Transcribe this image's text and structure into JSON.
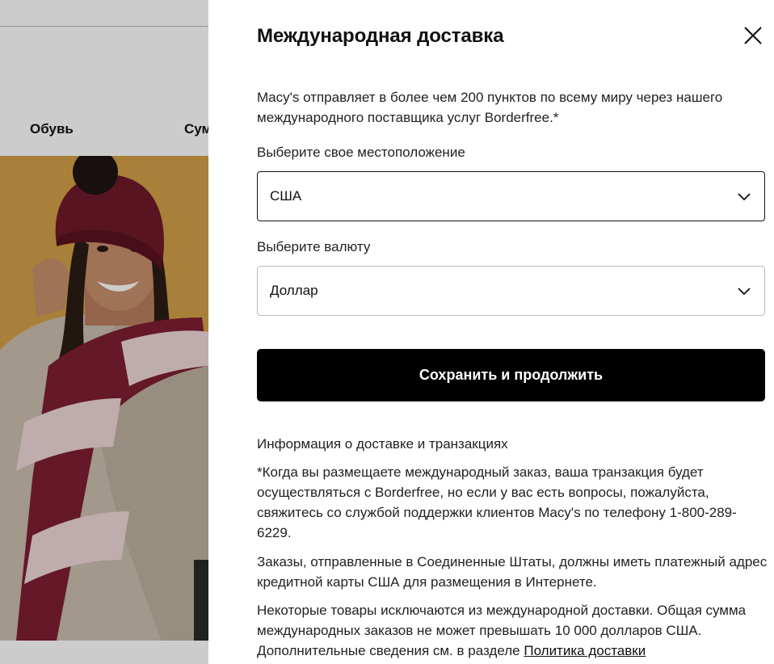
{
  "background_page": {
    "nav_items": [
      "Обувь",
      "Сум"
    ]
  },
  "drawer": {
    "title": "Международная доставка",
    "intro": "Macy's отправляет в более чем 200 пунктов по всему миру через нашего международного поставщика услуг Borderfree.*",
    "location_label": "Выберите свое местоположение",
    "location_value": "США",
    "currency_label": "Выберите валюту",
    "currency_value": "Доллар",
    "save_button": "Сохранить и продолжить",
    "info_title": "Информация о доставке и транзакциях",
    "info_p1": "*Когда вы размещаете международный заказ, ваша транзакция будет осуществляться с Borderfree, но если у вас есть вопросы, пожалуйста, свяжитесь со службой поддержки клиентов Macy's по телефону 1-800-289-6229.",
    "info_p2": "Заказы, отправленные в Соединенные Штаты, должны иметь платежный адрес кредитной карты США для размещения в Интернете.",
    "info_p3_text": "Некоторые товары исключаются из международной доставки. Общая сумма международных заказов не может превышать 10 000 долларов США. Дополнительные сведения см. в разделе ",
    "info_p3_link": "Политика доставки"
  }
}
